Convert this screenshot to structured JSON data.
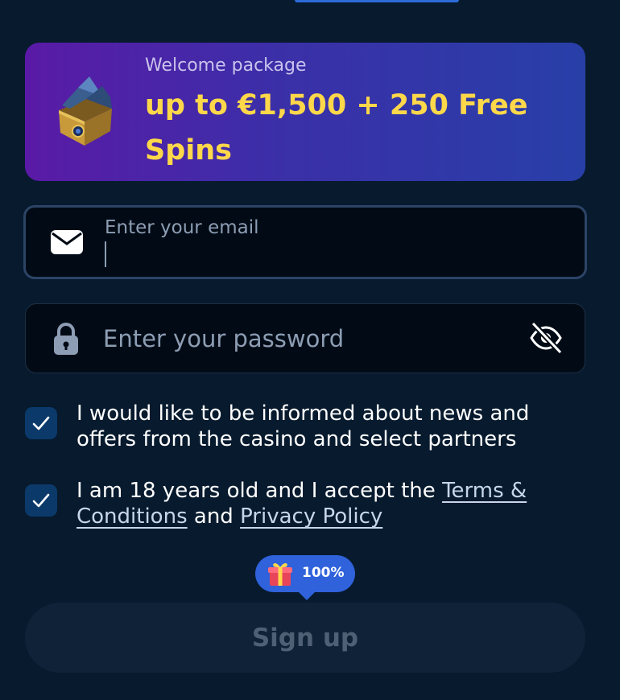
{
  "promo": {
    "kicker": "Welcome package",
    "headline": "up to €1,500 + 250 Free Spins"
  },
  "email": {
    "label": "Enter your email",
    "value": ""
  },
  "password": {
    "placeholder": "Enter your password"
  },
  "consents": [
    {
      "checked": true,
      "text": "I would like to be informed about news and offers from the casino and select partners"
    },
    {
      "checked": true,
      "text_before": "I am 18 years old and I accept the ",
      "terms_link": "Terms & Conditions",
      "text_middle": " and ",
      "privacy_link": "Privacy Policy"
    }
  ],
  "bonus_badge": {
    "icon": "gift-icon",
    "label": "100%"
  },
  "signup_button": {
    "label": "Sign up"
  },
  "colors": {
    "background": "#071a2e",
    "promo_start": "#5a1aa6",
    "promo_end": "#283fa8",
    "headline": "#ffd84a",
    "checkbox": "#0b3a6a",
    "badge": "#2f62db",
    "button_disabled": "#0f2238"
  }
}
